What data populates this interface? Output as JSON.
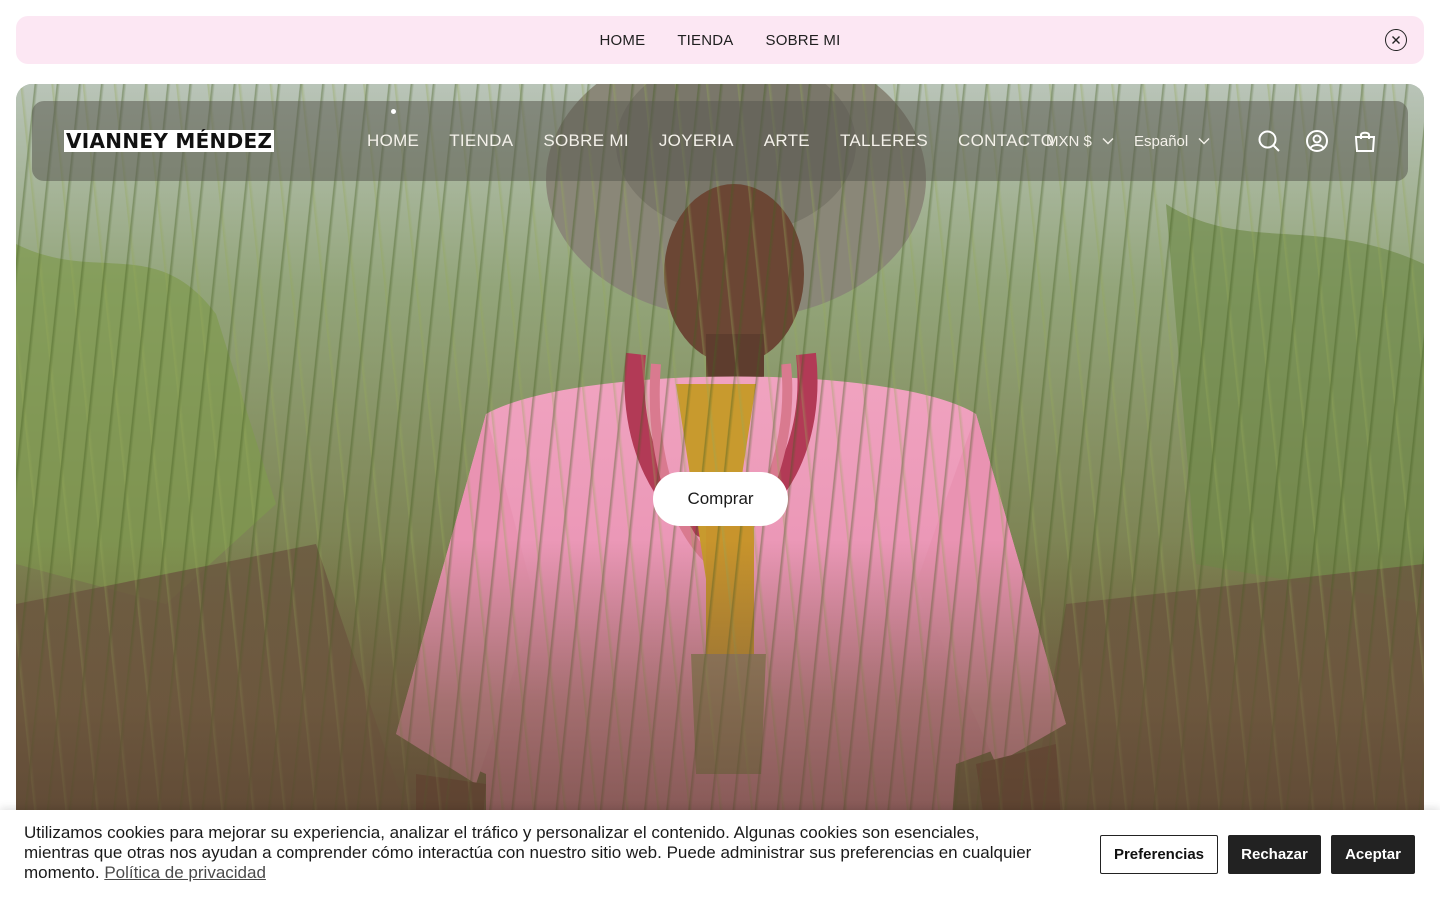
{
  "announcement": {
    "links": [
      "HOME",
      "TIENDA",
      "SOBRE MI"
    ],
    "close_icon": "close-circle-icon"
  },
  "header": {
    "logo": "VIANNEY MÉNDEZ",
    "menu": [
      "HOME",
      "TIENDA",
      "SOBRE MI",
      "JOYERIA",
      "ARTE",
      "TALLERES",
      "CONTACTO"
    ],
    "active_item": "HOME",
    "currency": "MXN $",
    "language": "Español",
    "icons": [
      "search-icon",
      "account-icon",
      "cart-icon"
    ]
  },
  "hero": {
    "cta_label": "Comprar"
  },
  "cookie_banner": {
    "text": "Utilizamos cookies para mejorar su experiencia, analizar el tráfico y personalizar el contenido. Algunas cookies son esenciales, mientras que otras nos ayudan a comprender cómo interactúa con nuestro sitio web. Puede administrar sus preferencias en cualquier momento.",
    "privacy_link": "Política de privacidad",
    "buttons": {
      "preferences": "Preferencias",
      "reject": "Rechazar",
      "accept": "Aceptar"
    }
  },
  "colors": {
    "announcement_bg": "#fce7f3",
    "dress_pink": "#e88aac",
    "button_dark": "#222222"
  }
}
